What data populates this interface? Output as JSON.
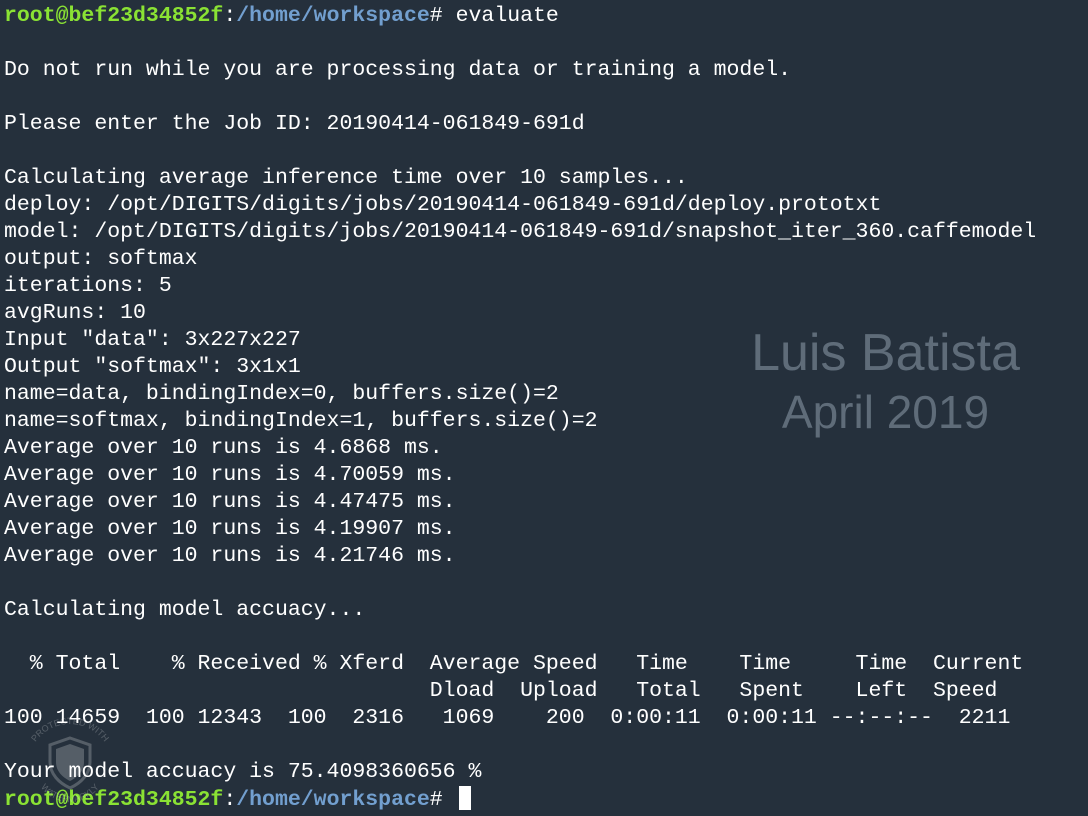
{
  "prompt": {
    "user_host": "root@bef23d34852f",
    "sep": ":",
    "path": "/home/workspace",
    "hash": "# "
  },
  "command": "evaluate",
  "lines": {
    "warning": "Do not run while you are processing data or training a model.",
    "job_id": "Please enter the Job ID: 20190414-061849-691d",
    "calc_inference": "Calculating average inference time over 10 samples...",
    "deploy": "deploy: /opt/DIGITS/digits/jobs/20190414-061849-691d/deploy.prototxt",
    "model": "model: /opt/DIGITS/digits/jobs/20190414-061849-691d/snapshot_iter_360.caffemodel",
    "output": "output: softmax",
    "iterations": "iterations: 5",
    "avg_runs": "avgRuns: 10",
    "input": "Input \"data\": 3x227x227",
    "output_shape": "Output \"softmax\": 3x1x1",
    "binding0": "name=data, bindingIndex=0, buffers.size()=2",
    "binding1": "name=softmax, bindingIndex=1, buffers.size()=2",
    "avg1": "Average over 10 runs is 4.6868 ms.",
    "avg2": "Average over 10 runs is 4.70059 ms.",
    "avg3": "Average over 10 runs is 4.47475 ms.",
    "avg4": "Average over 10 runs is 4.19907 ms.",
    "avg5": "Average over 10 runs is 4.21746 ms.",
    "calc_accuracy": "Calculating model accuacy...",
    "curl_header1": "  % Total    % Received % Xferd  Average Speed   Time    Time     Time  Current",
    "curl_header2": "                                 Dload  Upload   Total   Spent    Left  Speed",
    "curl_progress": "100 14659  100 12343  100  2316   1069    200  0:00:11  0:00:11 --:--:--  2211",
    "accuracy": "Your model accuacy is 75.4098360656 %"
  },
  "watermark": {
    "name": "Luis Batista",
    "date": "April 2019",
    "badge_text": "PROTECTED WITH WATERMARKLY"
  },
  "colors": {
    "background": "#25303c",
    "prompt_user": "#8ae234",
    "prompt_path": "#729fcf",
    "text": "#ffffff"
  }
}
